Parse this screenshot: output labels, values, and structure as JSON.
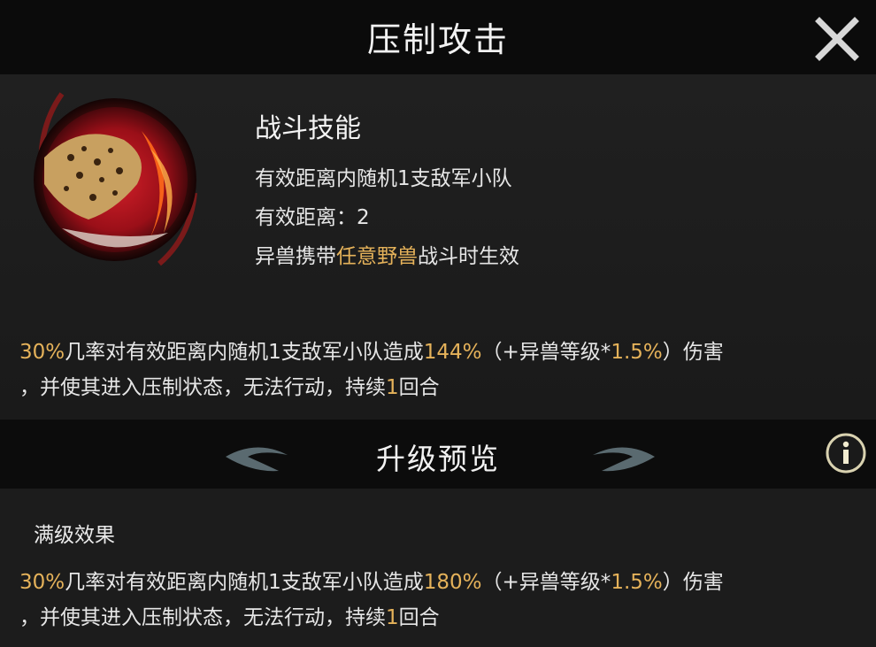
{
  "header": {
    "title": "压制攻击",
    "close_icon": "close-icon"
  },
  "skill": {
    "icon": "leopard-skill-icon",
    "type": "战斗技能",
    "target": "有效距离内随机1支敌军小队",
    "range_label": "有效距离：",
    "range_value": "2",
    "condition_prefix": "异兽携带",
    "condition_highlight": "任意野兽",
    "condition_suffix": "战斗时生效"
  },
  "description": {
    "chance": "30%",
    "part1": "几率对有效距离内随机1支敌军小队造成",
    "damage": "144%",
    "part2": "（+异兽等级*",
    "scale": "1.5%",
    "part3": "）伤害",
    "part4": "，并使其进入压制状态，无法行动，持续",
    "duration": "1",
    "part5": "回合"
  },
  "upgrade": {
    "title": "升级预览",
    "info_icon": "info-icon"
  },
  "max_level": {
    "label": "满级效果",
    "chance": "30%",
    "part1": "几率对有效距离内随机1支敌军小队造成",
    "damage": "180%",
    "part2": "（+异兽等级*",
    "scale": "1.5%",
    "part3": "）伤害",
    "part4": "，并使其进入压制状态，无法行动，持续",
    "duration": "1",
    "part5": "回合"
  },
  "colors": {
    "highlight": "#e5b25a",
    "background": "#141414"
  }
}
